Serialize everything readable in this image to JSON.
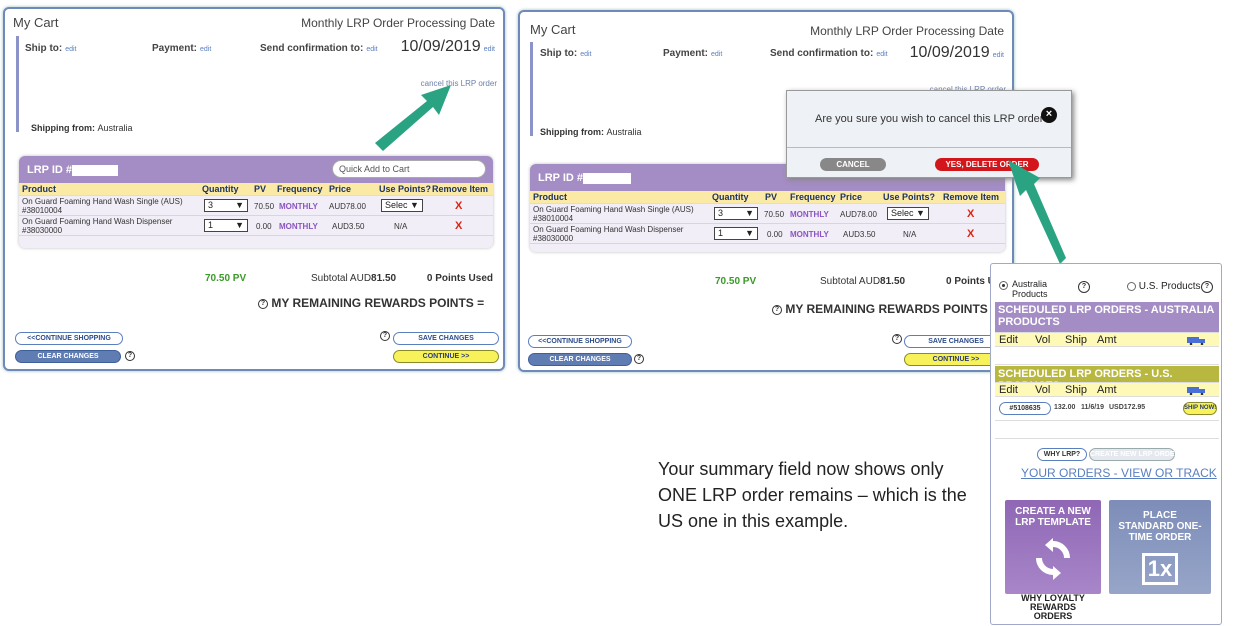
{
  "panel_left": {
    "title": "My Cart",
    "processing_label": "Monthly LRP Order Processing Date",
    "ship_to_label": "Ship to:",
    "payment_label": "Payment:",
    "send_conf_label": "Send confirmation to:",
    "edit_label": "edit",
    "date": "10/09/2019",
    "cancel_link": "cancel this LRP order",
    "shipping_from_label": "Shipping from:",
    "shipping_from_value": "Australia",
    "lrp_id_label": "LRP ID #",
    "quick_add_placeholder": "Quick Add to Cart",
    "table_headers": [
      "Product",
      "Quantity",
      "PV",
      "Frequency",
      "Price",
      "Use Points?",
      "Remove Item"
    ],
    "rows": [
      {
        "product": "On Guard Foaming Hand Wash Single (AUS) #38010004",
        "qty": "3",
        "pv": "70.50",
        "frequency": "MONTHLY",
        "price": "AUD78.00",
        "points": "Selec",
        "remove": "X"
      },
      {
        "product": "On Guard Foaming Hand Wash Dispenser #38030000",
        "qty": "1",
        "pv": "0.00",
        "frequency": "MONTHLY",
        "price": "AUD3.50",
        "points": "N/A",
        "remove": "X"
      }
    ],
    "pv_total": "70.50 PV",
    "subtotal_label": "Subtotal AUD",
    "subtotal_value": "81.50",
    "points_used": "0 Points Used",
    "remaining_label": "MY REMAINING REWARDS POINTS =",
    "continue_shopping": "<<CONTINUE SHOPPING",
    "clear_changes": "CLEAR CHANGES",
    "save_changes": "SAVE CHANGES",
    "continue": "CONTINUE >>"
  },
  "panel_middle": {
    "title": "My Cart",
    "processing_label": "Monthly LRP Order Processing Date",
    "ship_to_label": "Ship to:",
    "payment_label": "Payment:",
    "send_conf_label": "Send confirmation to:",
    "edit_label": "edit",
    "date": "10/09/2019",
    "cancel_link": "cancel this LRP order",
    "shipping_from_label": "Shipping from:",
    "shipping_from_value": "Australia",
    "lrp_id_label": "LRP ID #",
    "table_headers": [
      "Product",
      "Quantity",
      "PV",
      "Frequency",
      "Price",
      "Use Points?",
      "Remove Item"
    ],
    "rows": [
      {
        "product": "On Guard Foaming Hand Wash Single (AUS) #38010004",
        "qty": "3",
        "pv": "70.50",
        "frequency": "MONTHLY",
        "price": "AUD78.00",
        "points": "Selec",
        "remove": "X"
      },
      {
        "product": "On Guard Foaming Hand Wash Dispenser #38030000",
        "qty": "1",
        "pv": "0.00",
        "frequency": "MONTHLY",
        "price": "AUD3.50",
        "points": "N/A",
        "remove": "X"
      }
    ],
    "pv_total": "70.50 PV",
    "subtotal_label": "Subtotal AUD",
    "subtotal_value": "81.50",
    "points_used": "0 Points U",
    "remaining_label": "MY REMAINING REWARDS POINTS =",
    "continue_shopping": "<<CONTINUE SHOPPING",
    "clear_changes": "CLEAR CHANGES",
    "save_changes": "SAVE CHANGES",
    "continue": "CONTINUE >>",
    "dialog": {
      "text": "Are you sure you wish to cancel this LRP order?",
      "cancel": "CANCEL",
      "confirm": "YES, DELETE ORDER"
    }
  },
  "summary_text": "Your summary field now shows only ONE LRP order remains – which is the US one in this example.",
  "right_panel": {
    "radio_au": "Australia Products",
    "radio_us": "U.S. Products",
    "au_header": "SCHEDULED LRP ORDERS - AUSTRALIA PRODUCTS",
    "us_header": "SCHEDULED LRP ORDERS - U.S. PRODUCTS",
    "cols": [
      "Edit",
      "Vol",
      "Ship",
      "Amt"
    ],
    "us_row": {
      "id": "#5108635",
      "vol": "132.00",
      "ship": "11/6/19",
      "amt": "USD172.95",
      "ship_now": "SHIP NOW!"
    },
    "why_lrp": "WHY LRP?",
    "create_new": "CREATE NEW LRP ORDER",
    "your_orders": "YOUR ORDERS - VIEW OR TRACK",
    "tile_create": "CREATE A NEW LRP TEMPLATE",
    "tile_place": "PLACE STANDARD ONE-TIME ORDER",
    "tile_place_icon": "1x",
    "why_loyalty": "WHY LOYALTY REWARDS ORDERS"
  },
  "colors": {
    "purple_header": "#a48cc4",
    "yellow_header": "#fbe9a6",
    "green_arrow": "#2aa383",
    "red_button": "#d3161b",
    "olive_header": "#b8b841"
  }
}
